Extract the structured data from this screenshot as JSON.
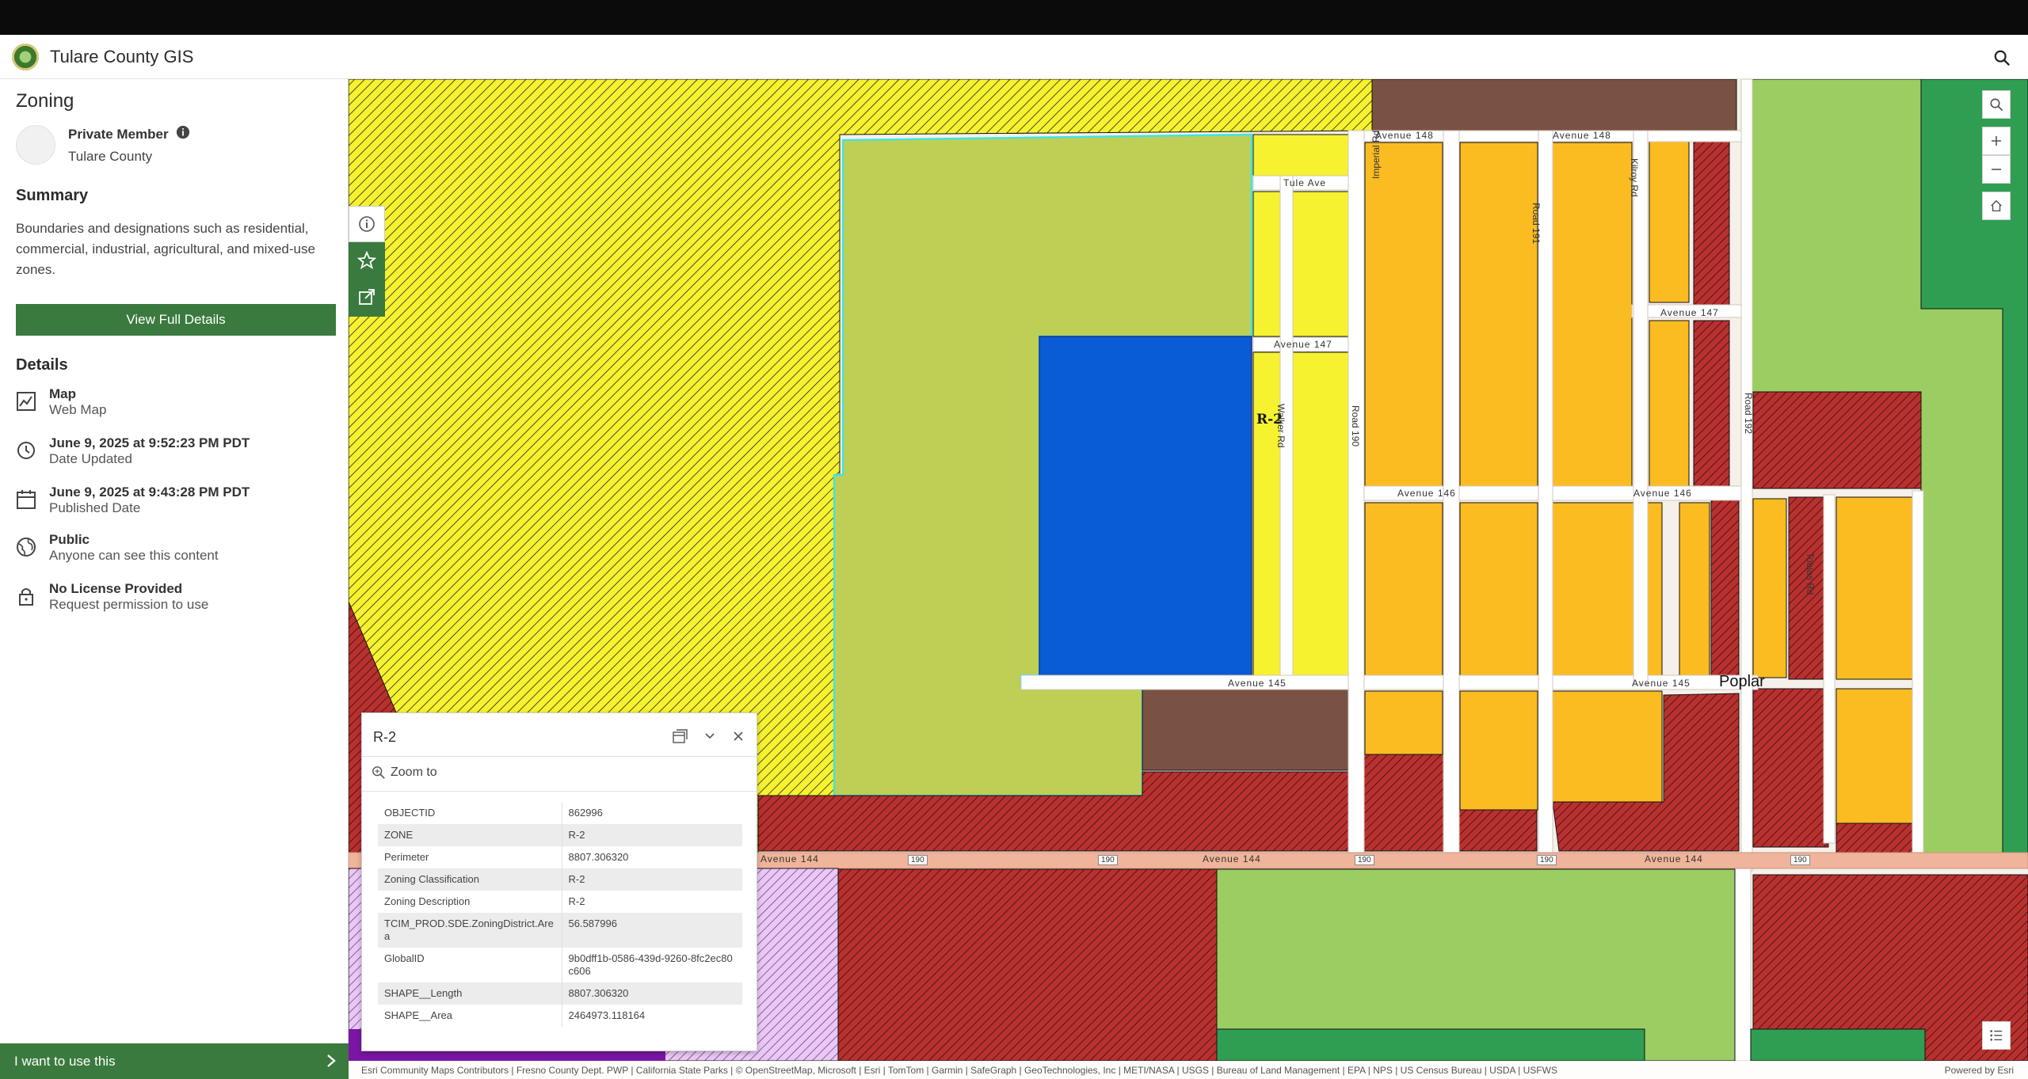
{
  "app": {
    "title": "Tulare County GIS"
  },
  "sidebar": {
    "title": "Zoning",
    "owner": "Private Member",
    "org": "Tulare County",
    "summary_heading": "Summary",
    "summary": "Boundaries and designations such as residential, commercial, industrial, agricultural, and mixed-use zones.",
    "view_button": "View Full Details",
    "details_heading": "Details",
    "details": [
      {
        "icon": "map-icon",
        "title": "Map",
        "sub": "Web Map"
      },
      {
        "icon": "history-icon",
        "title": "June 9, 2025 at 9:52:23 PM PDT",
        "sub": "Date Updated"
      },
      {
        "icon": "calendar-icon",
        "title": "June 9, 2025 at 9:43:28 PM PDT",
        "sub": "Published Date"
      },
      {
        "icon": "globe-icon",
        "title": "Public",
        "sub": "Anyone can see this content"
      },
      {
        "icon": "lock-icon",
        "title": "No License Provided",
        "sub": "Request permission to use"
      }
    ],
    "i_want": "I want to use this"
  },
  "map": {
    "zone_label": "R-2",
    "place_label": "Poplar",
    "roads": {
      "avenue_148": "Avenue 148",
      "avenue_147": "Avenue 147",
      "avenue_146": "Avenue 146",
      "avenue_145": "Avenue 145",
      "avenue_144": "Avenue 144",
      "tule_ave": "Tule Ave",
      "imperial_rd": "Imperial Rd",
      "road_191": "Road 191",
      "kilroy_rd": "Kilroy Rd",
      "road_192": "Road 192",
      "walker_rd": "Walker Rd",
      "road_190": "Road 190",
      "tobias_rd": "Tobias Rd",
      "hwy_190": "190"
    },
    "colors": {
      "agri_yellow": "#f6f22f",
      "rural_green": "#bfcf55",
      "school_blue": "#0a5bd6",
      "residential_orange": "#fbbc22",
      "commercial_red": "#b8312f",
      "industrial_brown": "#7a5244",
      "open_green": "#9ccd62",
      "park_green": "#2f9e52"
    }
  },
  "popup": {
    "title": "R-2",
    "zoom_to": "Zoom to",
    "rows": [
      {
        "key": "OBJECTID",
        "value": "862996"
      },
      {
        "key": "ZONE",
        "value": "R-2"
      },
      {
        "key": "Perimeter",
        "value": "8807.306320"
      },
      {
        "key": "Zoning Classification",
        "value": "R-2"
      },
      {
        "key": "Zoning Description",
        "value": "R-2"
      },
      {
        "key": "TCIM_PROD.SDE.ZoningDistrict.Area",
        "value": "56.587996"
      },
      {
        "key": "GlobalID",
        "value": "9b0dff1b-0586-439d-9260-8fc2ec80c606"
      },
      {
        "key": "SHAPE__Length",
        "value": "8807.306320"
      },
      {
        "key": "SHAPE__Area",
        "value": "2464973.118164"
      }
    ]
  },
  "attribution": {
    "text": "Esri Community Maps Contributors | Fresno County Dept. PWP | California State Parks | © OpenStreetMap, Microsoft | Esri | TomTom | Garmin | SafeGraph | GeoTechnologies, Inc | METI/NASA | USGS | Bureau of Land Management | EPA | NPS | US Census Bureau | USDA | USFWS",
    "powered": "Powered by Esri"
  }
}
